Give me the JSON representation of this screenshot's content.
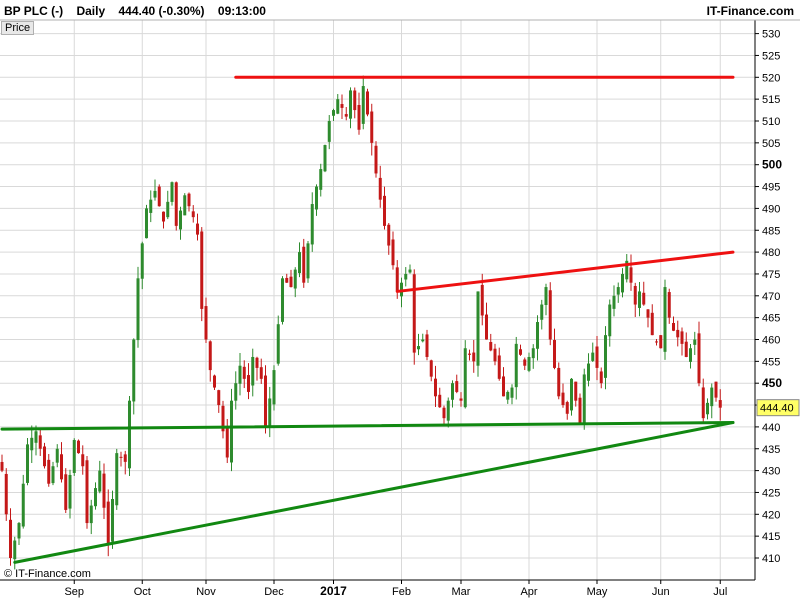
{
  "header": {
    "symbol": "BP PLC (-)",
    "timeframe": "Daily",
    "quote": "444.40 (-0.30%)",
    "time": "09:13:00",
    "brand": "IT-Finance.com",
    "price_label": "Price",
    "copyright": "© IT-Finance.com"
  },
  "colors": {
    "up_candle": "#2e8b2e",
    "down_candle": "#c41818",
    "resistance_line": "#ee1111",
    "support_line": "#118811",
    "grid": "#d9d9d9",
    "last_price_bg": "#ffff66"
  },
  "chart_data": {
    "type": "candlestick",
    "title": "BP PLC (-)",
    "ylabel": "Price",
    "ylim": [
      406,
      532
    ],
    "yticks": [
      410,
      415,
      420,
      425,
      430,
      435,
      440,
      445,
      450,
      455,
      460,
      465,
      470,
      475,
      480,
      485,
      490,
      495,
      500,
      505,
      510,
      515,
      520,
      525,
      530
    ],
    "yticks_bold": [
      450,
      500
    ],
    "xtick_labels": [
      "Sep",
      "Oct",
      "Nov",
      "Dec",
      "2017",
      "Feb",
      "Mar",
      "Apr",
      "May",
      "Jun",
      "Jul"
    ],
    "xtick_bold": [
      "2017"
    ],
    "last_price": "444.40",
    "grid": true,
    "trendlines": [
      {
        "name": "resistance-top",
        "color": "red",
        "from": [
          55,
          520
        ],
        "to": [
          172,
          520
        ]
      },
      {
        "name": "resistance-rising",
        "color": "red",
        "from": [
          93,
          471
        ],
        "to": [
          172,
          480
        ]
      },
      {
        "name": "support-horizontal",
        "color": "green",
        "from": [
          0,
          439.5
        ],
        "to": [
          172,
          441
        ]
      },
      {
        "name": "support-rising",
        "color": "green",
        "from": [
          3,
          409
        ],
        "to": [
          172,
          441
        ]
      }
    ],
    "anchors": [
      [
        0,
        430
      ],
      [
        2,
        410
      ],
      [
        4,
        418
      ],
      [
        6,
        436
      ],
      [
        8,
        439
      ],
      [
        11,
        427
      ],
      [
        13,
        435
      ],
      [
        15,
        421
      ],
      [
        17,
        437
      ],
      [
        19,
        431
      ],
      [
        20,
        418
      ],
      [
        23,
        430
      ],
      [
        25,
        413
      ],
      [
        27,
        434
      ],
      [
        29,
        432
      ],
      [
        30,
        446
      ],
      [
        32,
        474
      ],
      [
        34,
        490
      ],
      [
        36,
        494
      ],
      [
        38,
        487
      ],
      [
        40,
        496
      ],
      [
        41,
        486
      ],
      [
        43,
        493
      ],
      [
        45,
        488
      ],
      [
        46,
        484
      ],
      [
        47,
        467
      ],
      [
        49,
        453
      ],
      [
        51,
        445
      ],
      [
        53,
        433
      ],
      [
        54,
        446
      ],
      [
        56,
        454
      ],
      [
        58,
        448
      ],
      [
        59,
        456
      ],
      [
        61,
        451
      ],
      [
        62,
        440
      ],
      [
        64,
        453
      ],
      [
        66,
        474
      ],
      [
        68,
        472
      ],
      [
        70,
        480
      ],
      [
        71,
        473
      ],
      [
        73,
        491
      ],
      [
        75,
        499
      ],
      [
        77,
        510
      ],
      [
        79,
        515
      ],
      [
        81,
        511
      ],
      [
        82,
        517
      ],
      [
        84,
        508
      ],
      [
        85,
        518
      ],
      [
        87,
        505
      ],
      [
        88,
        498
      ],
      [
        90,
        486
      ],
      [
        92,
        477
      ],
      [
        93,
        471
      ],
      [
        95,
        475
      ],
      [
        96,
        476
      ],
      [
        97,
        457
      ],
      [
        99,
        460
      ],
      [
        100,
        456
      ],
      [
        102,
        447
      ],
      [
        104,
        442
      ],
      [
        106,
        450
      ],
      [
        108,
        446
      ],
      [
        109,
        458
      ],
      [
        111,
        455
      ],
      [
        112,
        471
      ],
      [
        114,
        460
      ],
      [
        116,
        455
      ],
      [
        118,
        447
      ],
      [
        120,
        449
      ],
      [
        121,
        459
      ],
      [
        123,
        454
      ],
      [
        125,
        458
      ],
      [
        126,
        464
      ],
      [
        128,
        472
      ],
      [
        129,
        460
      ],
      [
        131,
        447
      ],
      [
        133,
        443
      ],
      [
        134,
        451
      ],
      [
        136,
        441
      ],
      [
        137,
        452
      ],
      [
        139,
        457
      ],
      [
        141,
        450
      ],
      [
        142,
        461
      ],
      [
        143,
        468
      ],
      [
        145,
        472
      ],
      [
        146,
        475
      ],
      [
        147,
        478
      ],
      [
        149,
        468
      ],
      [
        150,
        471
      ],
      [
        152,
        465
      ],
      [
        153,
        461
      ],
      [
        155,
        458
      ],
      [
        156,
        472
      ],
      [
        157,
        465
      ],
      [
        158,
        462
      ],
      [
        160,
        459
      ],
      [
        161,
        456
      ],
      [
        163,
        460
      ],
      [
        164,
        450
      ],
      [
        165,
        442
      ],
      [
        167,
        449
      ],
      [
        169,
        444.4
      ]
    ]
  }
}
